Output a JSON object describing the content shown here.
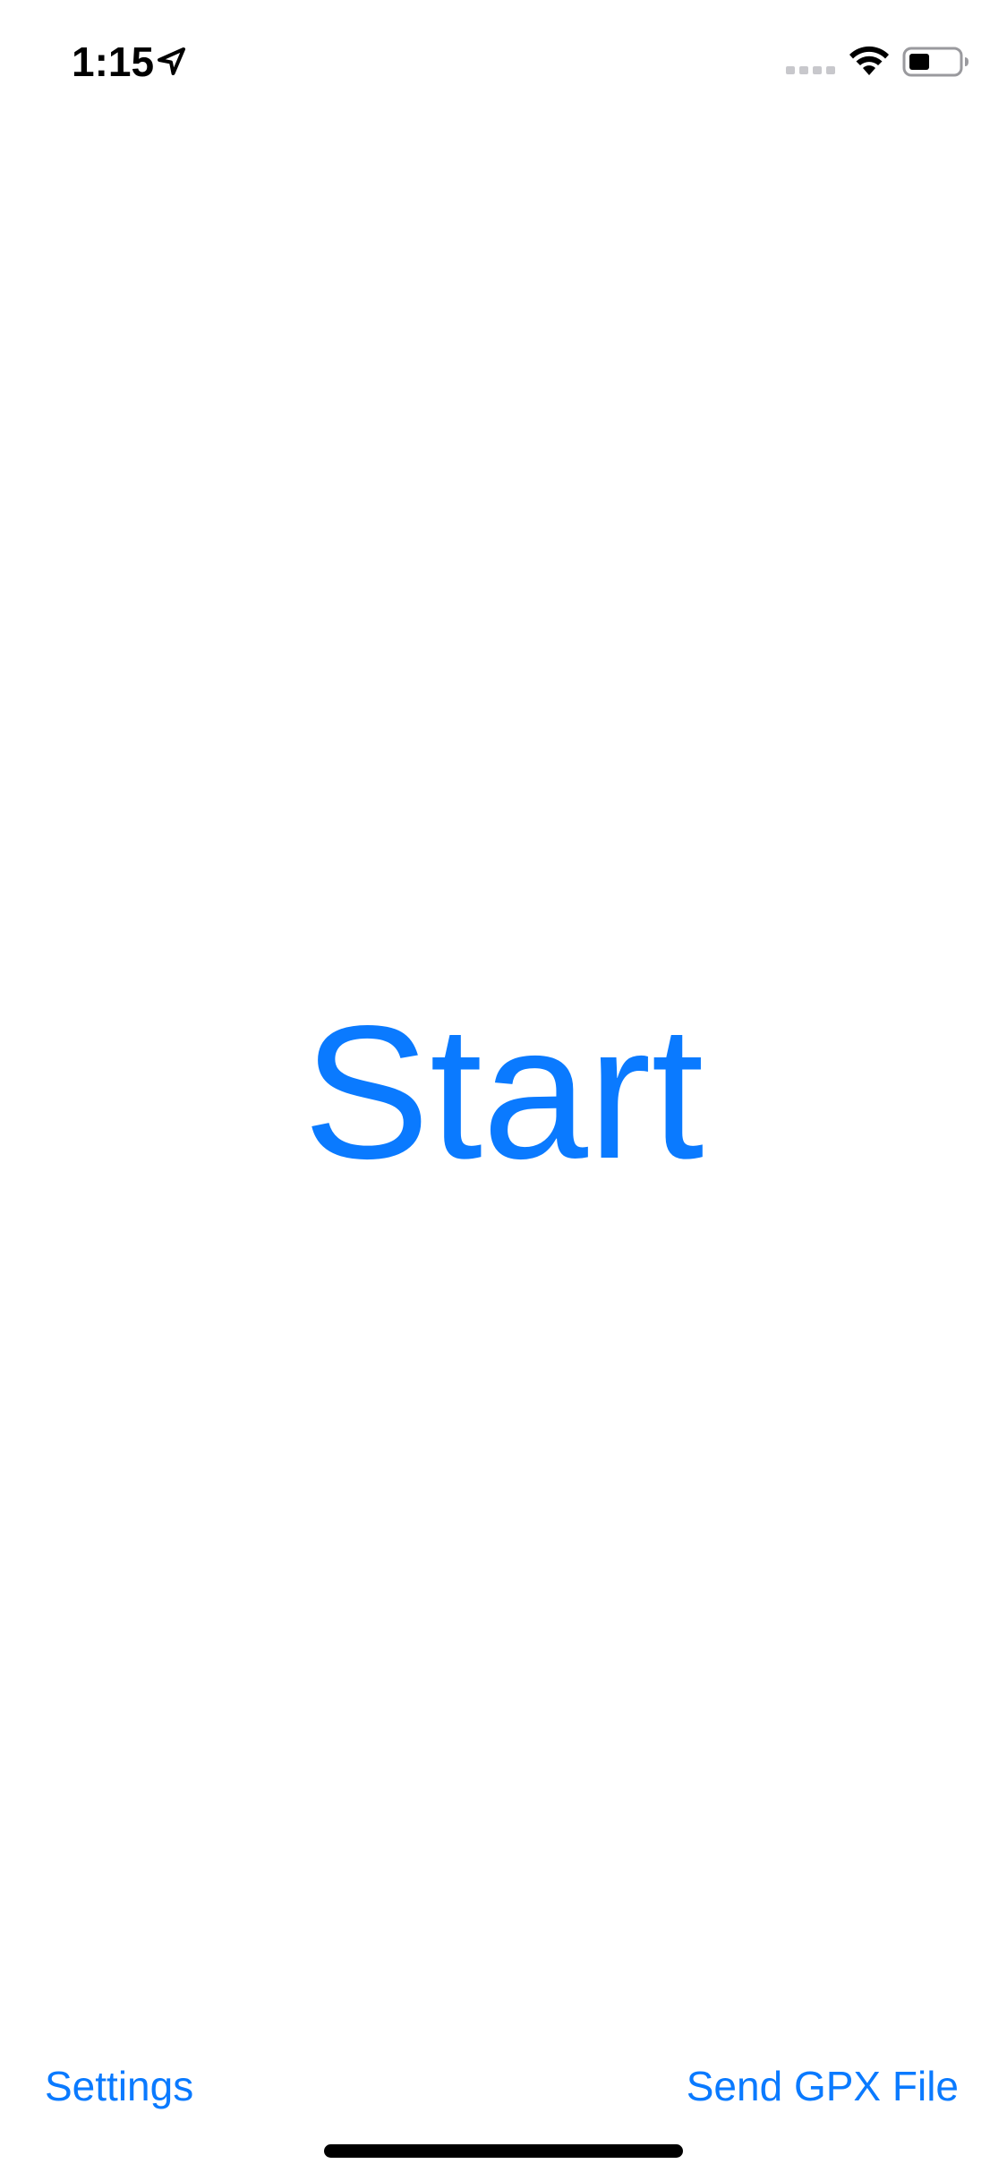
{
  "status_bar": {
    "time": "1:15",
    "icons": {
      "location": "location-arrow-icon",
      "signal": "signal-bars-icon",
      "wifi": "wifi-icon",
      "battery": "battery-icon"
    }
  },
  "main": {
    "start_label": "Start"
  },
  "bottom_bar": {
    "settings_label": "Settings",
    "send_gpx_label": "Send GPX File"
  },
  "colors": {
    "accent": "#0a7aff",
    "background": "#ffffff",
    "text": "#000000"
  }
}
